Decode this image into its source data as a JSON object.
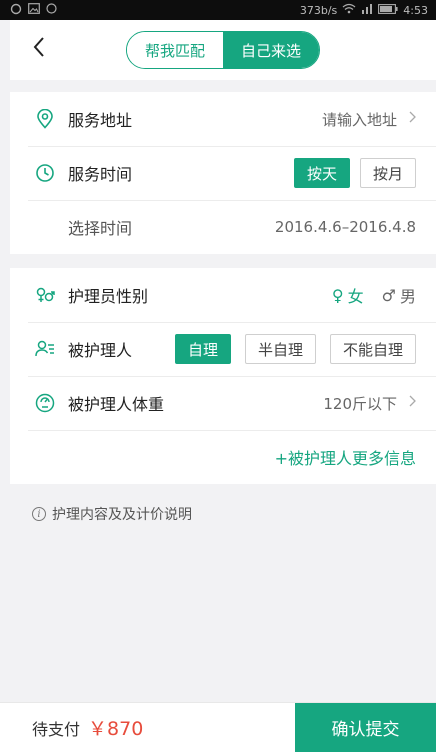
{
  "status_bar": {
    "speed": "373b/s",
    "time": "4:53"
  },
  "header": {
    "tabs": [
      {
        "label": "帮我匹配",
        "active": false
      },
      {
        "label": "自己来选",
        "active": true
      }
    ],
    "back_icon": "chevron-left-icon"
  },
  "service": {
    "address_label": "服务地址",
    "address_placeholder": "请输入地址",
    "time_label": "服务时间",
    "time_options": [
      "按天",
      "按月"
    ],
    "time_selected": "按天",
    "select_time_label": "选择时间",
    "select_time_value": "2016.4.6–2016.4.8"
  },
  "patient": {
    "gender_label": "护理员性别",
    "gender_options": [
      {
        "label": "女",
        "symbol": "♀",
        "selected": true
      },
      {
        "label": "男",
        "symbol": "♂",
        "selected": false
      }
    ],
    "person_label": "被护理人",
    "care_options": [
      "自理",
      "半自理",
      "不能自理"
    ],
    "care_selected": "自理",
    "weight_label": "被护理人体重",
    "weight_value": "120斤以下",
    "more_info": "+被护理人更多信息"
  },
  "note": "护理内容及及计价说明",
  "footer": {
    "pay_label": "待支付",
    "amount": "￥870",
    "submit_label": "确认提交"
  },
  "colors": {
    "accent": "#16a680",
    "price": "#e74c3c"
  }
}
